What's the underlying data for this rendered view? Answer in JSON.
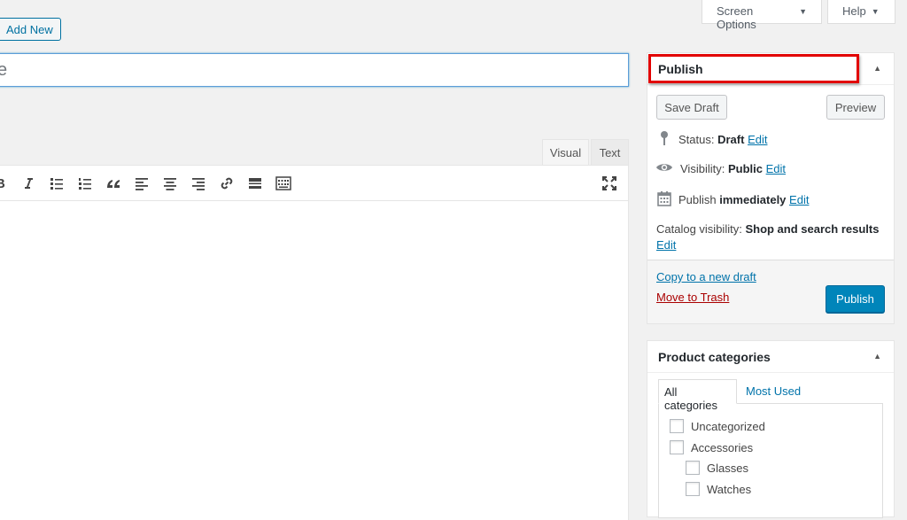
{
  "top": {
    "screen_options_label": "Screen Options",
    "help_label": "Help",
    "add_new_label": "Add New"
  },
  "title_field": {
    "value": "e"
  },
  "editor": {
    "tabs": [
      "Visual",
      "Text"
    ],
    "toolbar_icons": [
      "bold-icon",
      "italic-icon",
      "bulleted-list-icon",
      "numbered-list-icon",
      "blockquote-icon",
      "align-left-icon",
      "align-center-icon",
      "align-right-icon",
      "insert-link-icon",
      "read-more-icon",
      "toolbar-toggle-icon",
      "fullscreen-icon"
    ]
  },
  "publish": {
    "title": "Publish",
    "save_draft": "Save Draft",
    "preview": "Preview",
    "status_label": "Status:",
    "status_value": "Draft",
    "visibility_label": "Visibility:",
    "visibility_value": "Public",
    "publish_label": "Publish",
    "publish_value": "immediately",
    "edit": "Edit",
    "catalog_label": "Catalog visibility:",
    "catalog_value": "Shop and search results",
    "copy_draft": "Copy to a new draft",
    "move_trash": "Move to Trash",
    "publish_button": "Publish"
  },
  "categories": {
    "title": "Product categories",
    "tab_all": "All categories",
    "tab_most_used": "Most Used",
    "items": [
      "Uncategorized",
      "Accessories",
      "Glasses",
      "Watches"
    ]
  },
  "colors": {
    "accent": "#0085ba",
    "link": "#0073aa",
    "highlight": "#e20000",
    "trash": "#aa0000"
  }
}
